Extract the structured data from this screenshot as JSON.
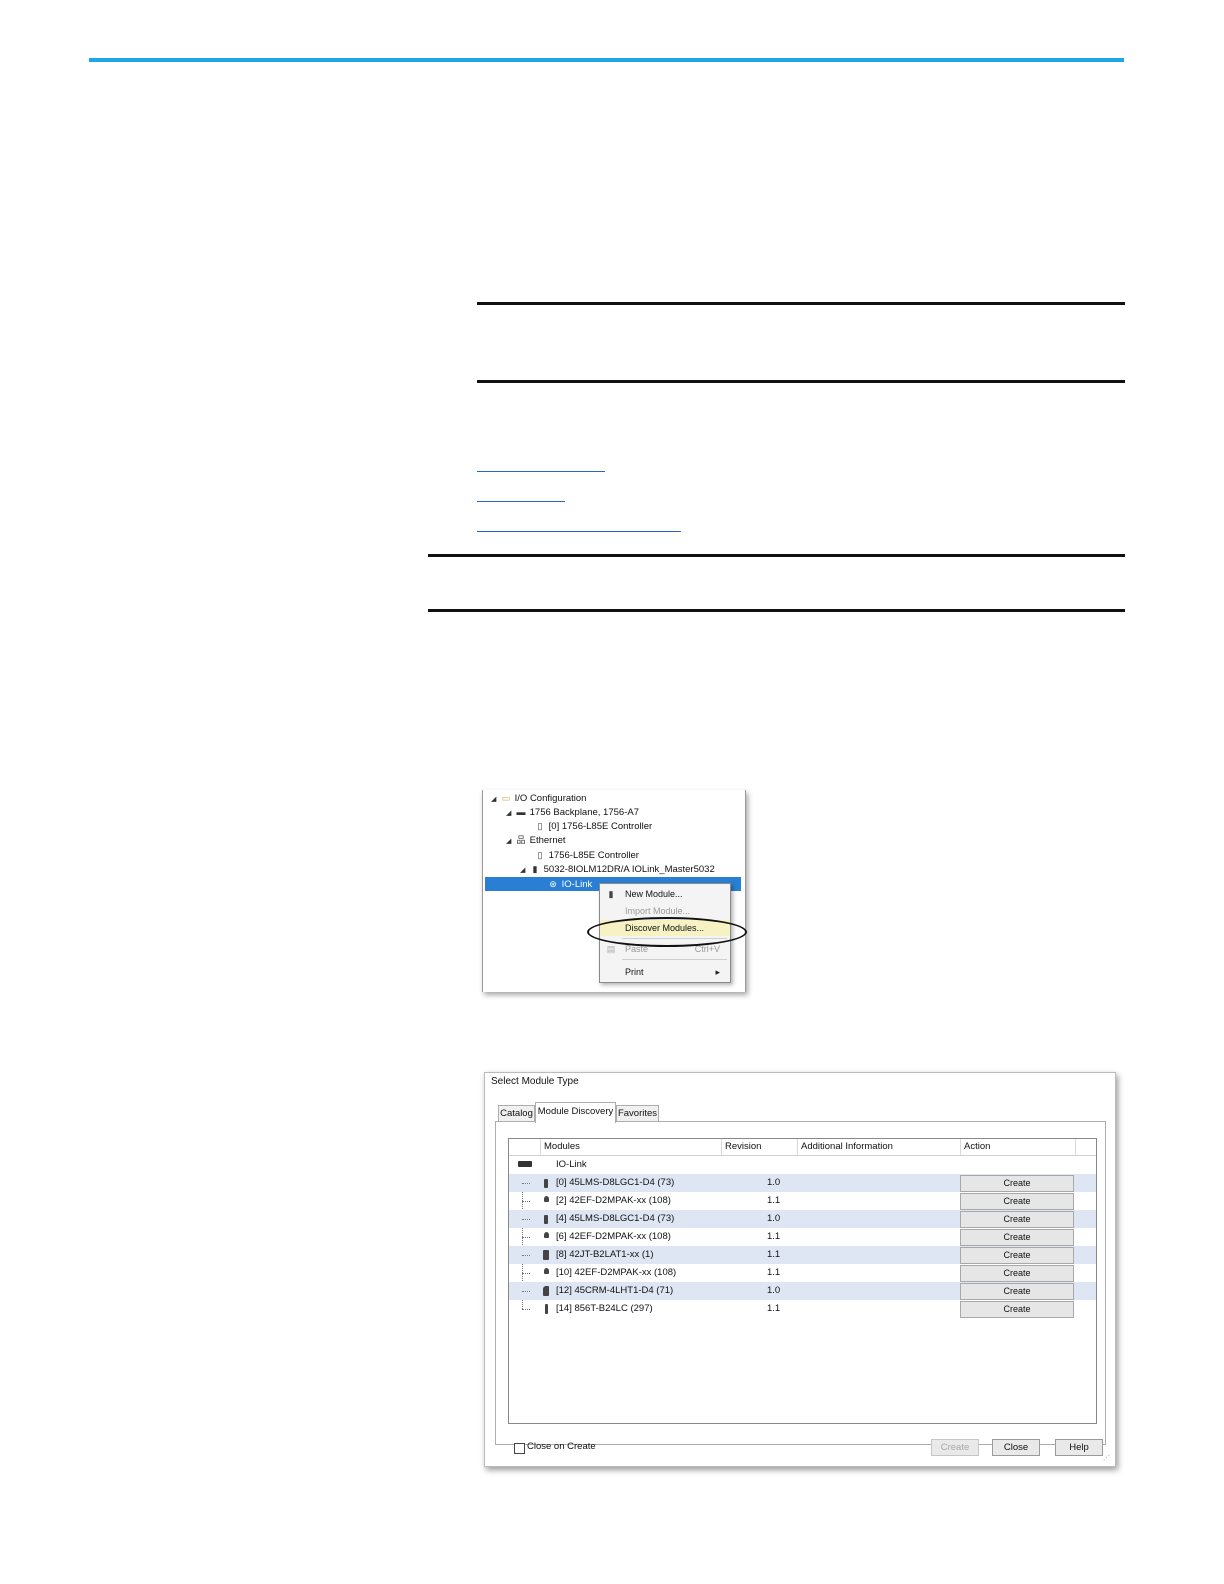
{
  "links": [
    "",
    "",
    ""
  ],
  "tree": {
    "items": [
      {
        "label": "I/O Configuration"
      },
      {
        "label": "1756 Backplane, 1756-A7"
      },
      {
        "label": "[0] 1756-L85E Controller"
      },
      {
        "label": "Ethernet"
      },
      {
        "label": "1756-L85E Controller"
      },
      {
        "label": "5032-8IOLM12DR/A IOLink_Master5032"
      },
      {
        "label": "IO-Link"
      }
    ],
    "menu": {
      "new_module": "New Module...",
      "import_module": "Import Module...",
      "discover_modules": "Discover Modules...",
      "paste": "Paste",
      "paste_shortcut": "Ctrl+V",
      "print": "Print"
    }
  },
  "dialog": {
    "title": "Select Module Type",
    "tabs": [
      "Catalog",
      "Module Discovery",
      "Favorites"
    ],
    "columns": [
      "Modules",
      "Revision",
      "Additional Information",
      "Action"
    ],
    "group": "IO-Link",
    "rows": [
      {
        "module": "[0] 45LMS-D8LGC1-D4 (73)",
        "revision": "1.0",
        "action": "Create"
      },
      {
        "module": "[2] 42EF-D2MPAK-xx (108)",
        "revision": "1.1",
        "action": "Create"
      },
      {
        "module": "[4] 45LMS-D8LGC1-D4 (73)",
        "revision": "1.0",
        "action": "Create"
      },
      {
        "module": "[6] 42EF-D2MPAK-xx (108)",
        "revision": "1.1",
        "action": "Create"
      },
      {
        "module": "[8] 42JT-B2LAT1-xx (1)",
        "revision": "1.1",
        "action": "Create"
      },
      {
        "module": "[10] 42EF-D2MPAK-xx (108)",
        "revision": "1.1",
        "action": "Create"
      },
      {
        "module": "[12] 45CRM-4LHT1-D4 (71)",
        "revision": "1.0",
        "action": "Create"
      },
      {
        "module": "[14] 856T-B24LC (297)",
        "revision": "1.1",
        "action": "Create"
      }
    ],
    "close_on_create": "Close on Create",
    "buttons": {
      "create": "Create",
      "close": "Close",
      "help": "Help"
    }
  }
}
